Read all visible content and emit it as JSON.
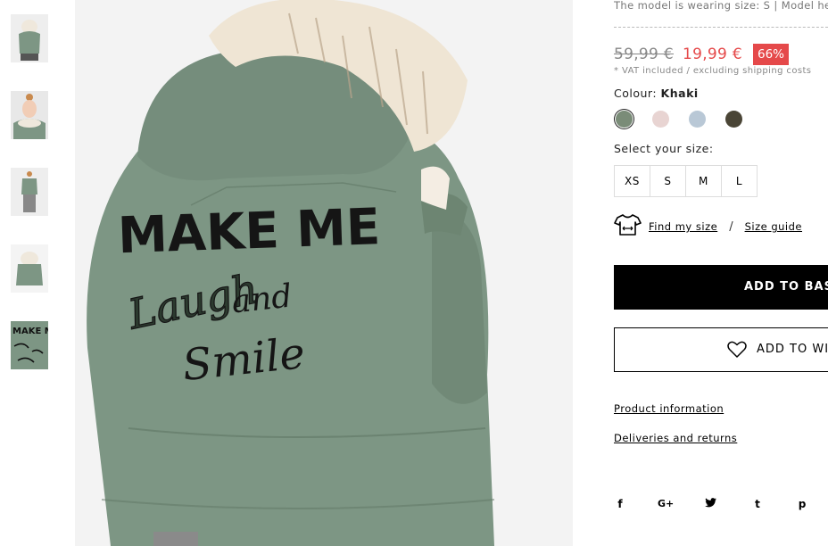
{
  "product": {
    "model_info": "The model is wearing size: S | Model height",
    "old_price": "59,99 €",
    "new_price": "19,99 €",
    "discount": "66%",
    "vat_note": "* VAT included / excluding shipping costs",
    "colour_label": "Colour:",
    "colour_value": "Khaki",
    "colours": [
      {
        "name": "khaki",
        "hex": "#7a8c78",
        "selected": true
      },
      {
        "name": "print",
        "hex": "#e8d4d2"
      },
      {
        "name": "light-blue",
        "hex": "#b9c8d6"
      },
      {
        "name": "camo",
        "hex": "#4a4536"
      }
    ],
    "size_label": "Select your size:",
    "sizes": [
      "XS",
      "S",
      "M",
      "L"
    ],
    "find_my_size": "Find my size",
    "size_separator": "/",
    "size_guide": "Size guide",
    "add_to_basket": "ADD TO BASKET",
    "add_to_wishlist": "ADD TO WISHLIST",
    "product_information": "Product information",
    "deliveries_returns": "Deliveries and returns",
    "social": [
      {
        "name": "facebook-icon",
        "glyph": "f"
      },
      {
        "name": "google-plus-icon",
        "glyph": "G+"
      },
      {
        "name": "twitter-icon",
        "glyph": "🐦"
      },
      {
        "name": "tumblr-icon",
        "glyph": "t"
      },
      {
        "name": "pinterest-icon",
        "glyph": "p"
      }
    ]
  },
  "image_text": {
    "line1": "MAKE ME",
    "line2": "Laugh",
    "line3": "and",
    "line4": "Smile"
  },
  "colors": {
    "sale_red": "#e5494a",
    "jacket_green": "#7d9684",
    "black": "#000000"
  }
}
